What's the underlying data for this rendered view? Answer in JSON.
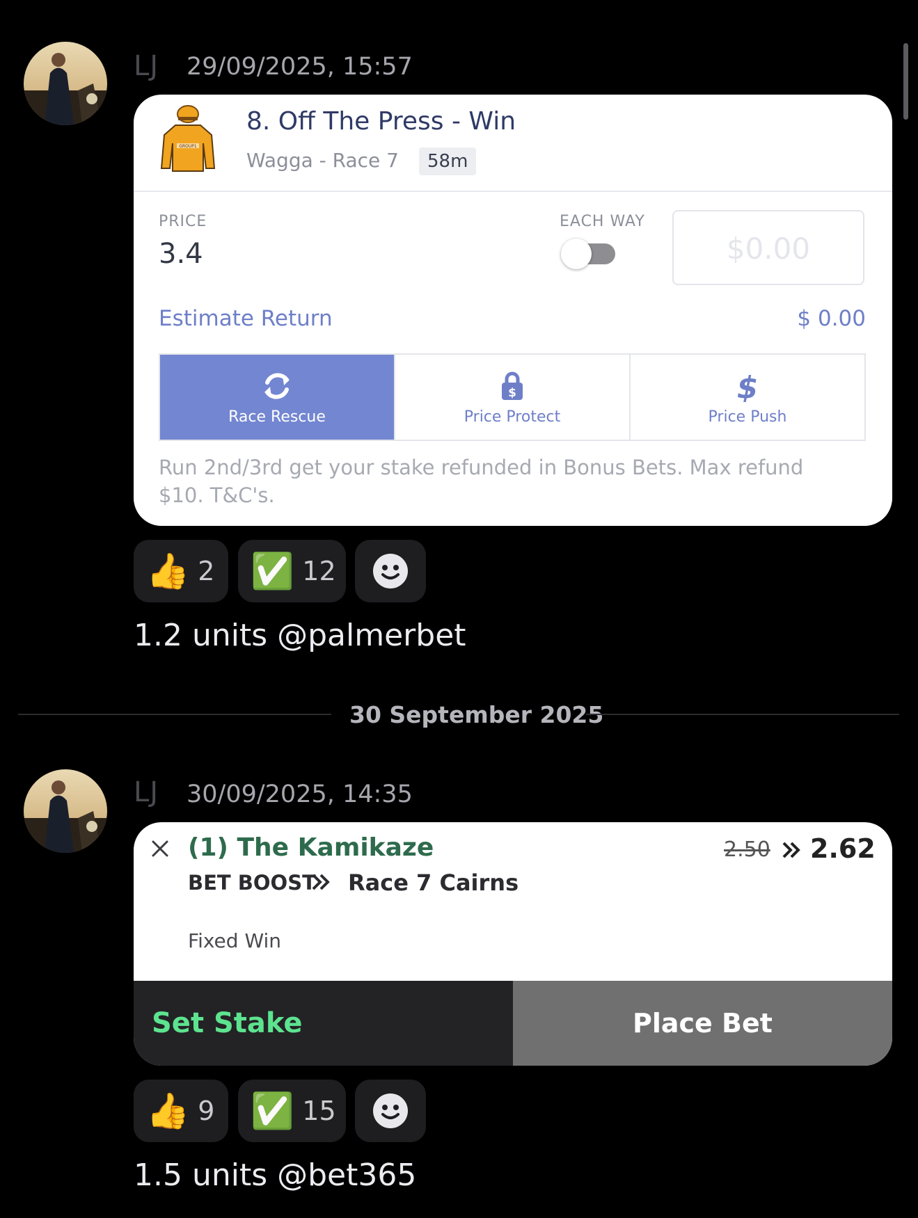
{
  "messages": [
    {
      "author": "LJ",
      "timestamp": "29/09/2025, 15:57",
      "card": {
        "selection": "8. Off The Press - Win",
        "race": "Wagga - Race 7",
        "time_badge": "58m",
        "price_label": "PRICE",
        "price": "3.4",
        "each_way_label": "EACH WAY",
        "stake_placeholder": "$0.00",
        "estimate_label": "Estimate Return",
        "estimate_value": "$ 0.00",
        "features": [
          {
            "label": "Race Rescue",
            "icon": "refresh-icon",
            "active": true
          },
          {
            "label": "Price Protect",
            "icon": "lock-dollar-icon",
            "active": false
          },
          {
            "label": "Price Push",
            "icon": "dollar-icon",
            "active": false
          }
        ],
        "note": "Run 2nd/3rd get your stake refunded in Bonus Bets. Max refund $10. T&C's."
      },
      "reactions": [
        {
          "emoji": "👍",
          "count": "2"
        },
        {
          "emoji": "✅",
          "count": "12"
        }
      ],
      "text": "1.2 units @palmerbet"
    },
    {
      "author": "LJ",
      "timestamp": "30/09/2025, 14:35",
      "card": {
        "selection": "(1) The Kamikaze",
        "boost_label": "BET BOOST",
        "race": "Race 7 Cairns",
        "old_price": "2.50",
        "new_price": "2.62",
        "market": "Fixed Win",
        "set_stake_label": "Set Stake",
        "place_bet_label": "Place Bet"
      },
      "reactions": [
        {
          "emoji": "👍",
          "count": "9"
        },
        {
          "emoji": "✅",
          "count": "15"
        }
      ],
      "text": "1.5 units @bet365"
    }
  ],
  "date_divider": "30 September 2025",
  "colors": {
    "background": "#000000",
    "card1_accent": "#7386d1",
    "card1_title": "#2f3a66",
    "card2_title": "#2e6b4d",
    "set_stake": "#5de38f"
  }
}
